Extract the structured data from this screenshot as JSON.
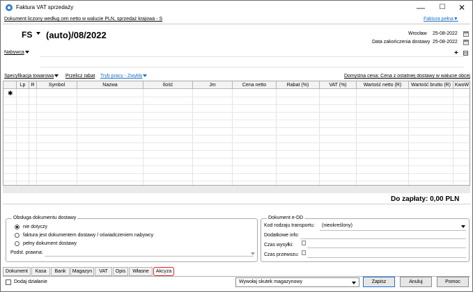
{
  "window": {
    "title": "Faktura VAT sprzedaży",
    "min_glyph": "—",
    "max_glyph": "☐",
    "close_glyph": "✕"
  },
  "header": {
    "doc_info": "Dokument liczony według cen netto w walucie PLN, sprzedaż krajowa - S",
    "doc_type_link": "Faktura pełna",
    "doc_type_caret": "▼",
    "series": "FS",
    "number": "(auto)/08/2022",
    "place_label": "Wrocław",
    "issue_date": "25-08-2022",
    "delivery_label": "Data zakończenia dostawy",
    "delivery_date": "25-08-2022"
  },
  "buyer": {
    "label": "Nabywca",
    "add_glyph": "+"
  },
  "toolbar": {
    "spec": "Specyfikacja towarowa",
    "recalc": "Przelicz rabat",
    "work_mode": "Tryb pracy - Zwykły",
    "default_price": "Domyślna cena: Cena z ostatniej dostawy w walucie obcej"
  },
  "grid": {
    "new_row_marker": "✱",
    "columns": [
      "",
      "Lp",
      "R",
      "Symbol",
      "Nazwa",
      "Ilość",
      "Jm",
      "Cena netto",
      "Rabat (%)",
      "VAT (%)",
      "Wartość netto (R)",
      "Wartość brutto (R)",
      "KwoW"
    ]
  },
  "totals": {
    "to_pay": "Do zapłaty: 0,00 PLN"
  },
  "delivery_box": {
    "title": "Obsługa dokumentu dostawy",
    "options": [
      "nie dotyczy",
      "faktura jest dokumentem dostawy / oświadczeniem nabywcy",
      "pełny dokument dostawy"
    ],
    "selected": 0,
    "legal_basis_label": "Podst. prawna:"
  },
  "edd_box": {
    "title": "Dokument e-DD",
    "transport_label": "Kod rodzaju transportu:",
    "transport_value": "(nieokreślony)",
    "extra_info_label": "Dodatkowe info:",
    "shipping_time_label": "Czas wysyłki:",
    "transport_time_label": "Czas przewozu:"
  },
  "tabs": [
    "Dokument",
    "Kasa",
    "Bank",
    "Magazyn",
    "VAT",
    "Opis",
    "Własne",
    "Akcyza"
  ],
  "footer": {
    "add_action": "Dodaj działanie",
    "effect_select": "Wywołaj skutek magazynowy",
    "save": "Zapisz",
    "cancel": "Anuluj",
    "help": "Pomoc"
  },
  "colors": {
    "link": "#1d6fc9",
    "highlight": "#e02020"
  }
}
